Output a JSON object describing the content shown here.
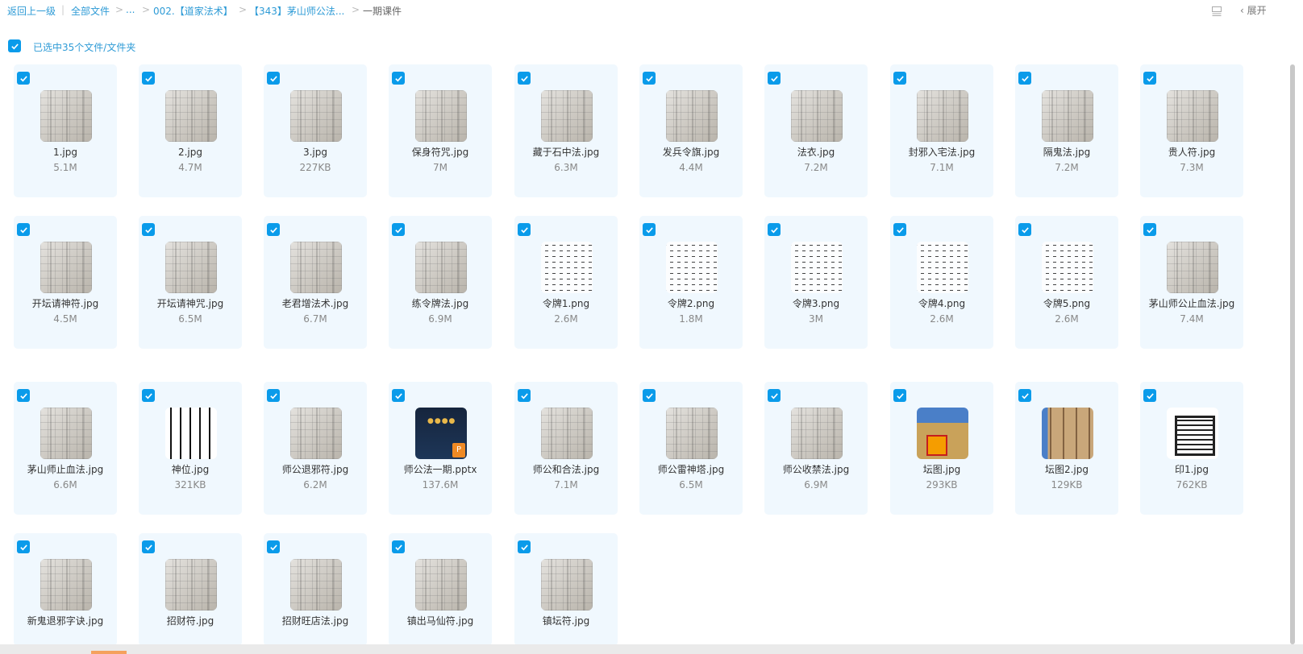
{
  "breadcrumb": {
    "back": "返回上一级",
    "all_files": "全部文件",
    "ellipsis": "...",
    "level1": "002.【道家法术】",
    "level2": "【343】茅山师公法...",
    "current": "一期课件"
  },
  "toolbar": {
    "layout_icon": "list-layout-icon",
    "expand_label": "展开"
  },
  "selection": {
    "summary": "已选中35个文件/文件夹"
  },
  "files": [
    {
      "name": "1.jpg",
      "size": "5.1M",
      "thumb": "photo"
    },
    {
      "name": "2.jpg",
      "size": "4.7M",
      "thumb": "photo"
    },
    {
      "name": "3.jpg",
      "size": "227KB",
      "thumb": "photo"
    },
    {
      "name": "保身符咒.jpg",
      "size": "7M",
      "thumb": "photo"
    },
    {
      "name": "藏于石中法.jpg",
      "size": "6.3M",
      "thumb": "photo"
    },
    {
      "name": "发兵令旗.jpg",
      "size": "4.4M",
      "thumb": "photo"
    },
    {
      "name": "法衣.jpg",
      "size": "7.2M",
      "thumb": "photo"
    },
    {
      "name": "封邪入宅法.jpg",
      "size": "7.1M",
      "thumb": "photo"
    },
    {
      "name": "隔鬼法.jpg",
      "size": "7.2M",
      "thumb": "photo"
    },
    {
      "name": "贵人符.jpg",
      "size": "7.3M",
      "thumb": "photo"
    },
    {
      "name": "开坛请神符.jpg",
      "size": "4.5M",
      "thumb": "photo"
    },
    {
      "name": "开坛请神咒.jpg",
      "size": "6.5M",
      "thumb": "photo"
    },
    {
      "name": "老君增法术.jpg",
      "size": "6.7M",
      "thumb": "photo"
    },
    {
      "name": "练令牌法.jpg",
      "size": "6.9M",
      "thumb": "photo"
    },
    {
      "name": "令牌1.png",
      "size": "2.6M",
      "thumb": "white"
    },
    {
      "name": "令牌2.png",
      "size": "1.8M",
      "thumb": "white"
    },
    {
      "name": "令牌3.png",
      "size": "3M",
      "thumb": "white"
    },
    {
      "name": "令牌4.png",
      "size": "2.6M",
      "thumb": "white"
    },
    {
      "name": "令牌5.png",
      "size": "2.6M",
      "thumb": "white"
    },
    {
      "name": "茅山师公止血法.jpg",
      "size": "7.4M",
      "thumb": "photo"
    },
    {
      "name": "茅山师止血法.jpg",
      "size": "6.6M",
      "thumb": "photo"
    },
    {
      "name": "神位.jpg",
      "size": "321KB",
      "thumb": "calli"
    },
    {
      "name": "师公退邪符.jpg",
      "size": "6.2M",
      "thumb": "photo"
    },
    {
      "name": "师公法一期.pptx",
      "size": "137.6M",
      "thumb": "pptx"
    },
    {
      "name": "师公和合法.jpg",
      "size": "7.1M",
      "thumb": "photo"
    },
    {
      "name": "师公雷神塔.jpg",
      "size": "6.5M",
      "thumb": "photo"
    },
    {
      "name": "师公收禁法.jpg",
      "size": "6.9M",
      "thumb": "photo"
    },
    {
      "name": "坛图.jpg",
      "size": "293KB",
      "thumb": "altar"
    },
    {
      "name": "坛图2.jpg",
      "size": "129KB",
      "thumb": "altar2"
    },
    {
      "name": "印1.jpg",
      "size": "762KB",
      "thumb": "seal"
    },
    {
      "name": "新鬼退邪字诀.jpg",
      "size": "",
      "thumb": "photo"
    },
    {
      "name": "招财符.jpg",
      "size": "",
      "thumb": "photo"
    },
    {
      "name": "招财旺店法.jpg",
      "size": "",
      "thumb": "photo"
    },
    {
      "name": "镇出马仙符.jpg",
      "size": "",
      "thumb": "photo"
    },
    {
      "name": "镇坛符.jpg",
      "size": "",
      "thumb": "photo"
    }
  ],
  "pptx_thumb": {
    "dots": "●●●●",
    "badge": "P"
  }
}
